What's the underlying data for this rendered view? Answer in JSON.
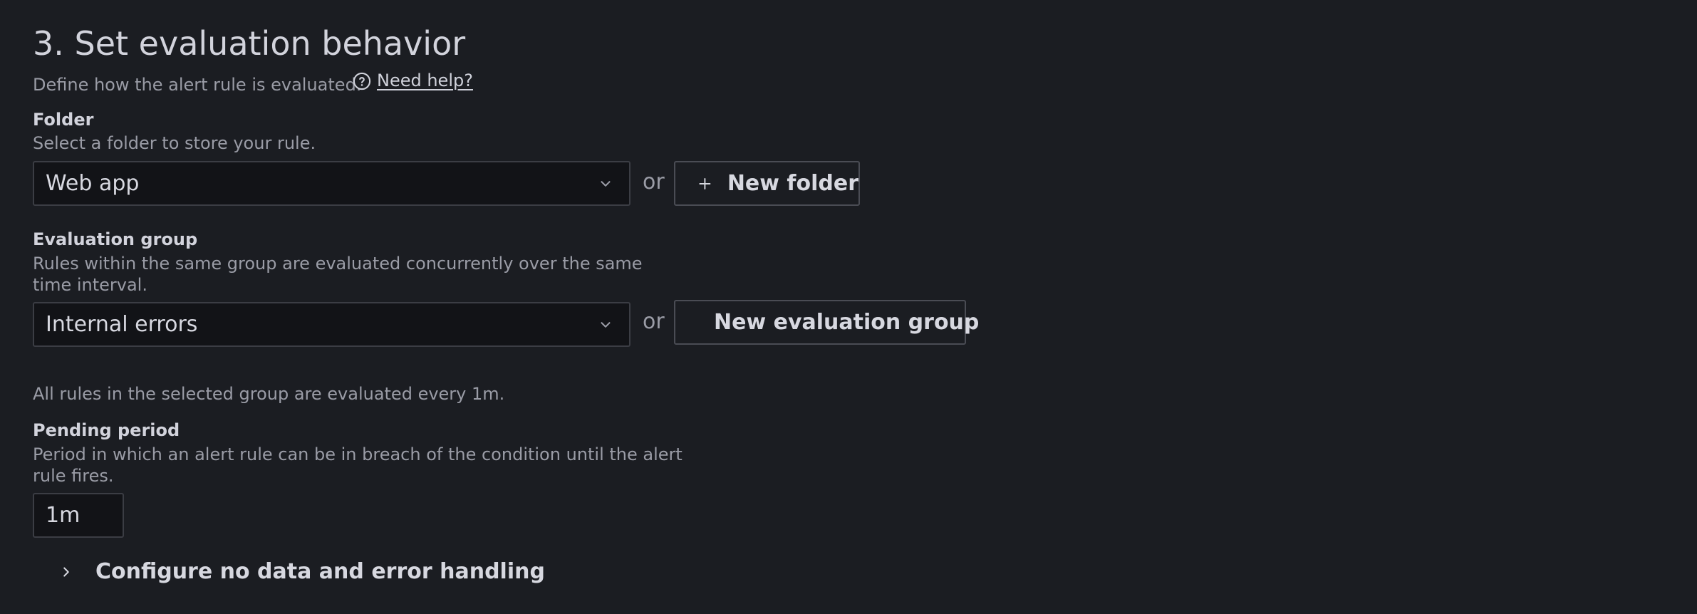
{
  "section": {
    "title": "3. Set evaluation behavior",
    "description": "Define how the alert rule is evaluated.",
    "help_link": "Need help?",
    "icon": "help-circle-icon"
  },
  "folder": {
    "label": "Folder",
    "hint": "Select a folder to store your rule.",
    "selected": "Web app",
    "or": "or",
    "new_button": "New folder"
  },
  "evaluation_group": {
    "label": "Evaluation group",
    "hint": "Rules within the same group are evaluated concurrently over the same time interval.",
    "selected": "Internal errors",
    "or": "or",
    "new_button": "New evaluation group",
    "info": "All rules in the selected group are evaluated every 1m."
  },
  "pending_period": {
    "label": "Pending period",
    "hint": "Period in which an alert rule can be in breach of the condition until the alert rule fires.",
    "value": "1m"
  },
  "no_data_section": {
    "label": "Configure no data and error handling"
  },
  "colors": {
    "background": "#1b1d22",
    "input_background": "#121317",
    "border": "#3b3d44",
    "text_primary": "#d7d8e0",
    "text_secondary": "#9a9ca6"
  }
}
